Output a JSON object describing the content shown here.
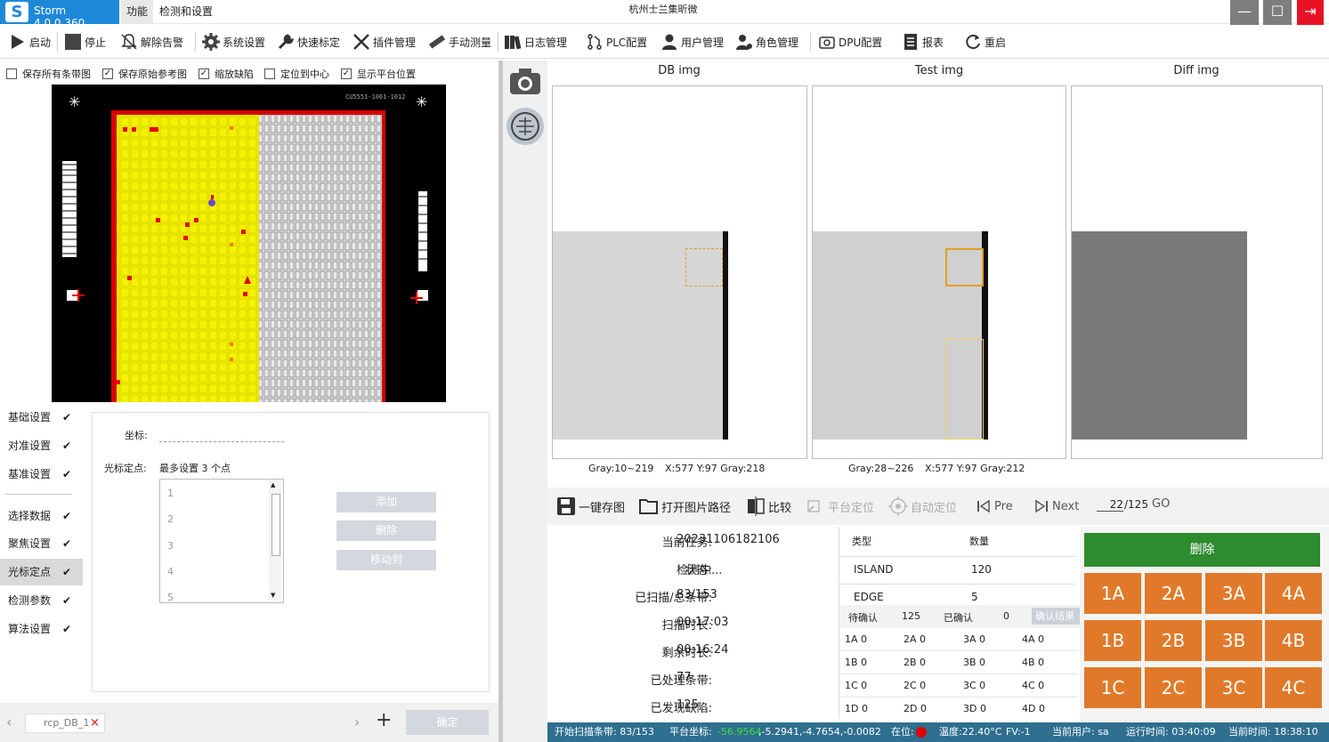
{
  "app": {
    "name": "Storm 4.0.0.360",
    "window_title": "杭州士兰集昕微",
    "menu": [
      "功能",
      "检测和设置"
    ]
  },
  "toolbar": [
    "启动",
    "停止",
    "解除告警",
    "系统设置",
    "快速标定",
    "插件管理",
    "手动测量",
    "日志管理",
    "PLC配置",
    "用户管理",
    "角色管理",
    "DPU配置",
    "报表",
    "重启"
  ],
  "checks": [
    {
      "label": "保存所有条带图",
      "checked": false
    },
    {
      "label": "保存原始参考图",
      "checked": true
    },
    {
      "label": "缩放缺陷",
      "checked": true
    },
    {
      "label": "定位到中心",
      "checked": false
    },
    {
      "label": "显示平台位置",
      "checked": true
    }
  ],
  "wafer": {
    "top_text": "CU5551-1061-1012"
  },
  "nav": [
    "基础设置",
    "对准设置",
    "基准设置",
    "选择数据",
    "聚焦设置",
    "光标定点",
    "检测参数",
    "算法设置"
  ],
  "nav_check": "✔",
  "panel": {
    "coord_label": "坐标:",
    "cursor_label": "光标定点:",
    "cursor_hint": "最多设置 3 个点",
    "list": [
      "1",
      "2",
      "3",
      "4",
      "5"
    ],
    "buttons": [
      "添加",
      "删除",
      "移动到"
    ]
  },
  "footer_left": {
    "recipe": "rcp_DB_1",
    "confirm": "确定",
    "plus": "+",
    "next": "›",
    "prev": "‹",
    "close": "×"
  },
  "images": {
    "headers": [
      "DB img",
      "Test img",
      "Diff img"
    ],
    "db_info": {
      "range": "Gray:10~219",
      "pos": "X:577 Y:97 Gray:218"
    },
    "test_info": {
      "range": "Gray:28~226",
      "pos": "X:577 Y:97 Gray:212"
    }
  },
  "actions": {
    "save": "一键存图",
    "open": "打开图片路径",
    "compare": "比较",
    "platform": "平台定位",
    "auto": "自动定位",
    "pre": "Pre",
    "next": "Next",
    "page": "22",
    "total": "/125",
    "go": "GO"
  },
  "info": [
    {
      "label": "当前任务:",
      "value": "20231106182106"
    },
    {
      "label": "状态:",
      "value": "检测中..."
    },
    {
      "label": "已扫描/总条带:",
      "value": "83/153"
    },
    {
      "label": "扫描时长:",
      "value": "00:17:03"
    },
    {
      "label": "剩余时长:",
      "value": "00:16:24"
    },
    {
      "label": "已处理条带:",
      "value": "77"
    },
    {
      "label": "已发现缺陷:",
      "value": "125"
    }
  ],
  "defects": {
    "header": [
      "类型",
      "数量"
    ],
    "rows": [
      [
        "ISLAND",
        "120"
      ],
      [
        "EDGE",
        "5"
      ]
    ],
    "pending_label": "待确认",
    "pending": "125",
    "confirmed_label": "已确认",
    "confirmed": "0",
    "confirm_btn": "确认结果",
    "grid": [
      [
        "1A 0",
        "2A 0",
        "3A 0",
        "4A 0"
      ],
      [
        "1B 0",
        "2B 0",
        "3B 0",
        "4B 0"
      ],
      [
        "1C 0",
        "2C 0",
        "3C 0",
        "4C 0"
      ],
      [
        "1D 0",
        "2D 0",
        "3D 0",
        "4D 0"
      ]
    ]
  },
  "classify": {
    "delete": "删除",
    "buttons": [
      "1A",
      "2A",
      "3A",
      "4A",
      "1B",
      "2B",
      "3B",
      "4B",
      "1C",
      "2C",
      "3C",
      "4C"
    ]
  },
  "status": {
    "scan": "开始扫描条带: 83/153",
    "coord_label": "平台坐标:",
    "coord_green": "-56.9564",
    "coord_rest": ",-5.2941,-4.7654,-0.0082",
    "inpos": "在位:",
    "temp": "温度:22.40°C",
    "fv": "FV:-1",
    "user": "当前用户: sa",
    "runtime": "运行时间: 03:40:09",
    "time": "当前时间: 18:38:10"
  }
}
